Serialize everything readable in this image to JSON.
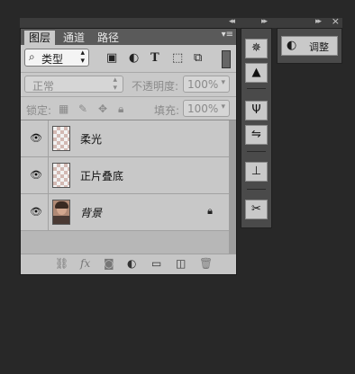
{
  "layers_panel": {
    "tabs": [
      "图层",
      "通道",
      "路径"
    ],
    "filter": {
      "icon": "search-icon",
      "label": "类型"
    },
    "filter_icons": [
      "image-icon",
      "adjustment-icon",
      "text-icon",
      "shape-icon",
      "smart-object-icon"
    ],
    "blend_mode": "正常",
    "opacity_label": "不透明度:",
    "opacity_value": "100%",
    "lock_label": "锁定:",
    "fill_label": "填充:",
    "fill_value": "100%",
    "layers": [
      {
        "name": "柔光",
        "visible": true,
        "thumb": "transparent",
        "locked": false
      },
      {
        "name": "正片叠底",
        "visible": true,
        "thumb": "transparent",
        "locked": false
      },
      {
        "name": "背景",
        "visible": true,
        "thumb": "photo",
        "locked": true
      }
    ],
    "bottom_icons": [
      "link-icon",
      "fx-icon",
      "mask-icon",
      "adjustment-layer-icon",
      "group-folder-icon",
      "new-layer-icon",
      "trash-icon"
    ],
    "bottom_text": {
      "fx": "fx"
    }
  },
  "tool_strip": [
    "navigator-icon",
    "histogram-icon",
    "brushes-icon",
    "brush-presets-icon",
    "clone-source-icon",
    "tool-presets-icon",
    "properties-tools-icon"
  ],
  "adjustments_button": {
    "label": "调整",
    "icon": "adjustments-icon"
  }
}
